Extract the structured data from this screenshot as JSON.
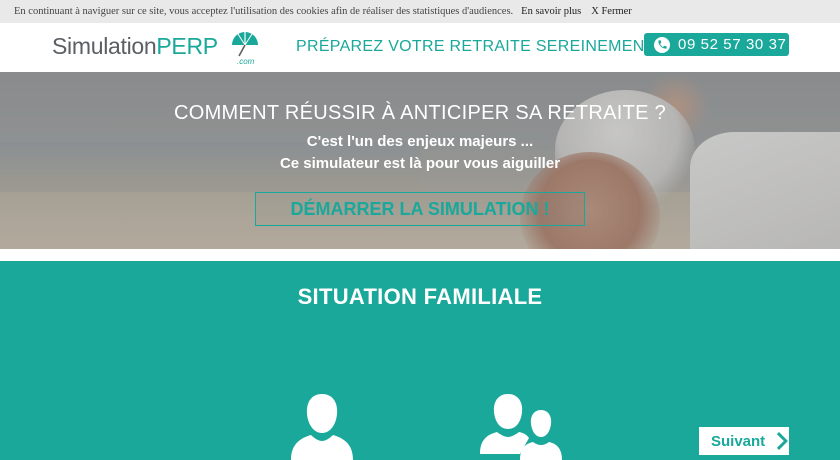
{
  "cookie_bar": {
    "text": "En continuant à naviguer sur ce site, vous acceptez l'utilisation des cookies afin de réaliser des statistiques d'audiences.",
    "learn_more": "En savoir plus",
    "close": "X Fermer"
  },
  "header": {
    "logo_part1": "Simulation",
    "logo_part2": "PERP",
    "logo_suffix": ".com",
    "tagline": "PRÉPAREZ VOTRE RETRAITE SEREINEMENT !",
    "phone": "09 52 57 30 37",
    "phone_icon": "phone-icon"
  },
  "hero": {
    "title": "COMMENT RÉUSSIR À ANTICIPER SA RETRAITE ?",
    "line1": "C'est l'un des enjeux majeurs ...",
    "line2": "Ce simulateur est là pour vous aiguiller",
    "cta": "DÉMARRER LA SIMULATION !"
  },
  "section": {
    "title": "SITUATION FAMILIALE",
    "option_single_icon": "single-person-icon",
    "option_couple_icon": "couple-icon",
    "next_label": "Suivant",
    "next_icon": "chevron-right-icon"
  },
  "colors": {
    "accent": "#1aa89b",
    "logo_grey": "#5a5f63",
    "cookie_bg": "#e9e9e9"
  }
}
